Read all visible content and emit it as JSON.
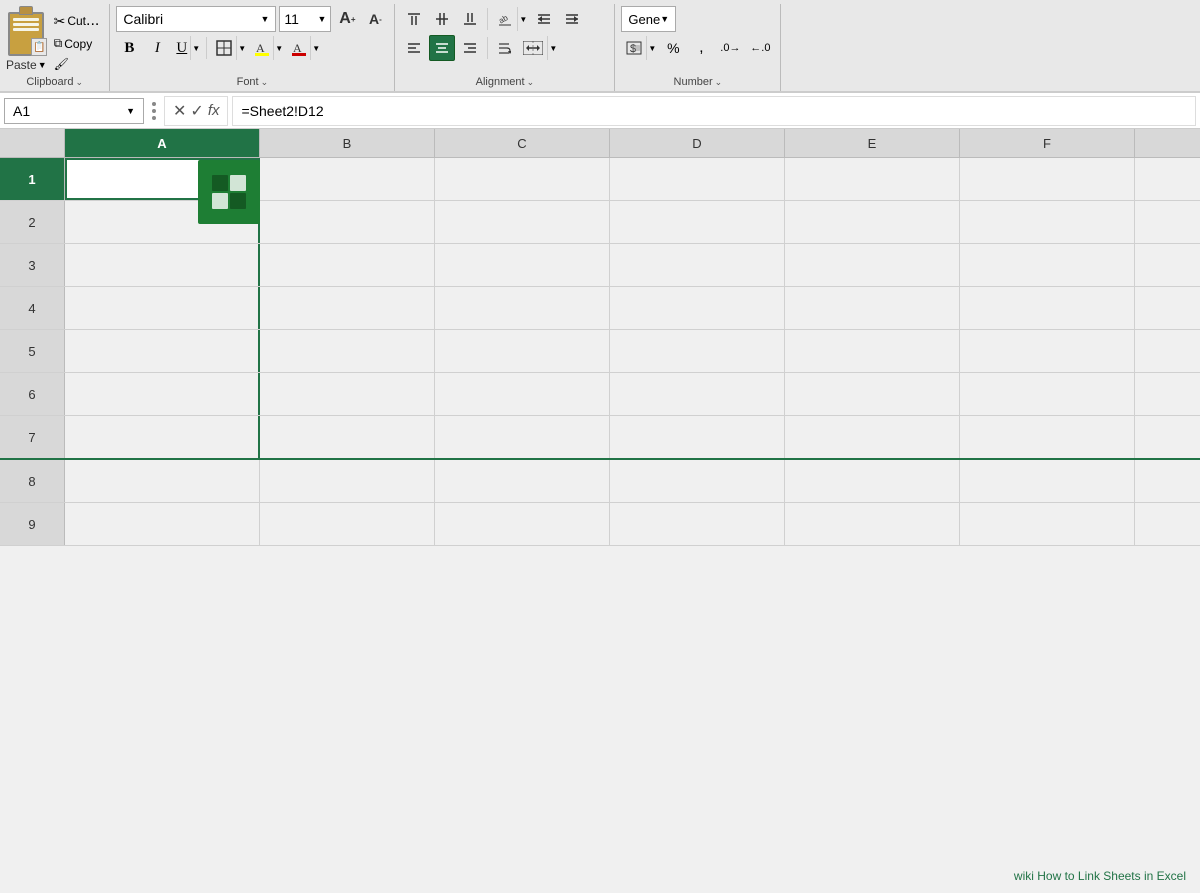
{
  "ribbon": {
    "clipboard_label": "Clipboard",
    "font_label": "Font",
    "alignment_label": "Alignment",
    "number_label": "Number",
    "paste_label": "Paste",
    "font_name": "Calibri",
    "font_size": "11",
    "bold_label": "B",
    "italic_label": "I",
    "underline_label": "U",
    "expand_icon": "⌄"
  },
  "formula_bar": {
    "cell_name": "A1",
    "formula": "=Sheet2!D12",
    "cancel_label": "✕",
    "confirm_label": "✓",
    "fx_label": "fx"
  },
  "columns": [
    "A",
    "B",
    "C",
    "D",
    "E",
    "F"
  ],
  "rows": [
    "1",
    "2",
    "3",
    "4",
    "5",
    "6",
    "7",
    "8",
    "9"
  ],
  "watermark": "wiki How to Link Sheets in Excel",
  "alignment_active": "center",
  "icons": {
    "cut": "✂",
    "copy": "⧉",
    "format_painter": "🖌",
    "bold": "B",
    "italic": "I",
    "underline": "U",
    "borders": "⊟",
    "fill": "A",
    "font_color": "A",
    "align_top": "⬆",
    "align_middle": "≡",
    "align_bottom": "⬇",
    "align_left": "≡",
    "align_center": "≡",
    "align_right": "≡",
    "indent_decrease": "◁",
    "indent_increase": "▷",
    "wrap_text": "↵",
    "merge": "⬛",
    "cancel": "✕",
    "confirm": "✓",
    "fx": "fx",
    "dropdown": "▼"
  }
}
